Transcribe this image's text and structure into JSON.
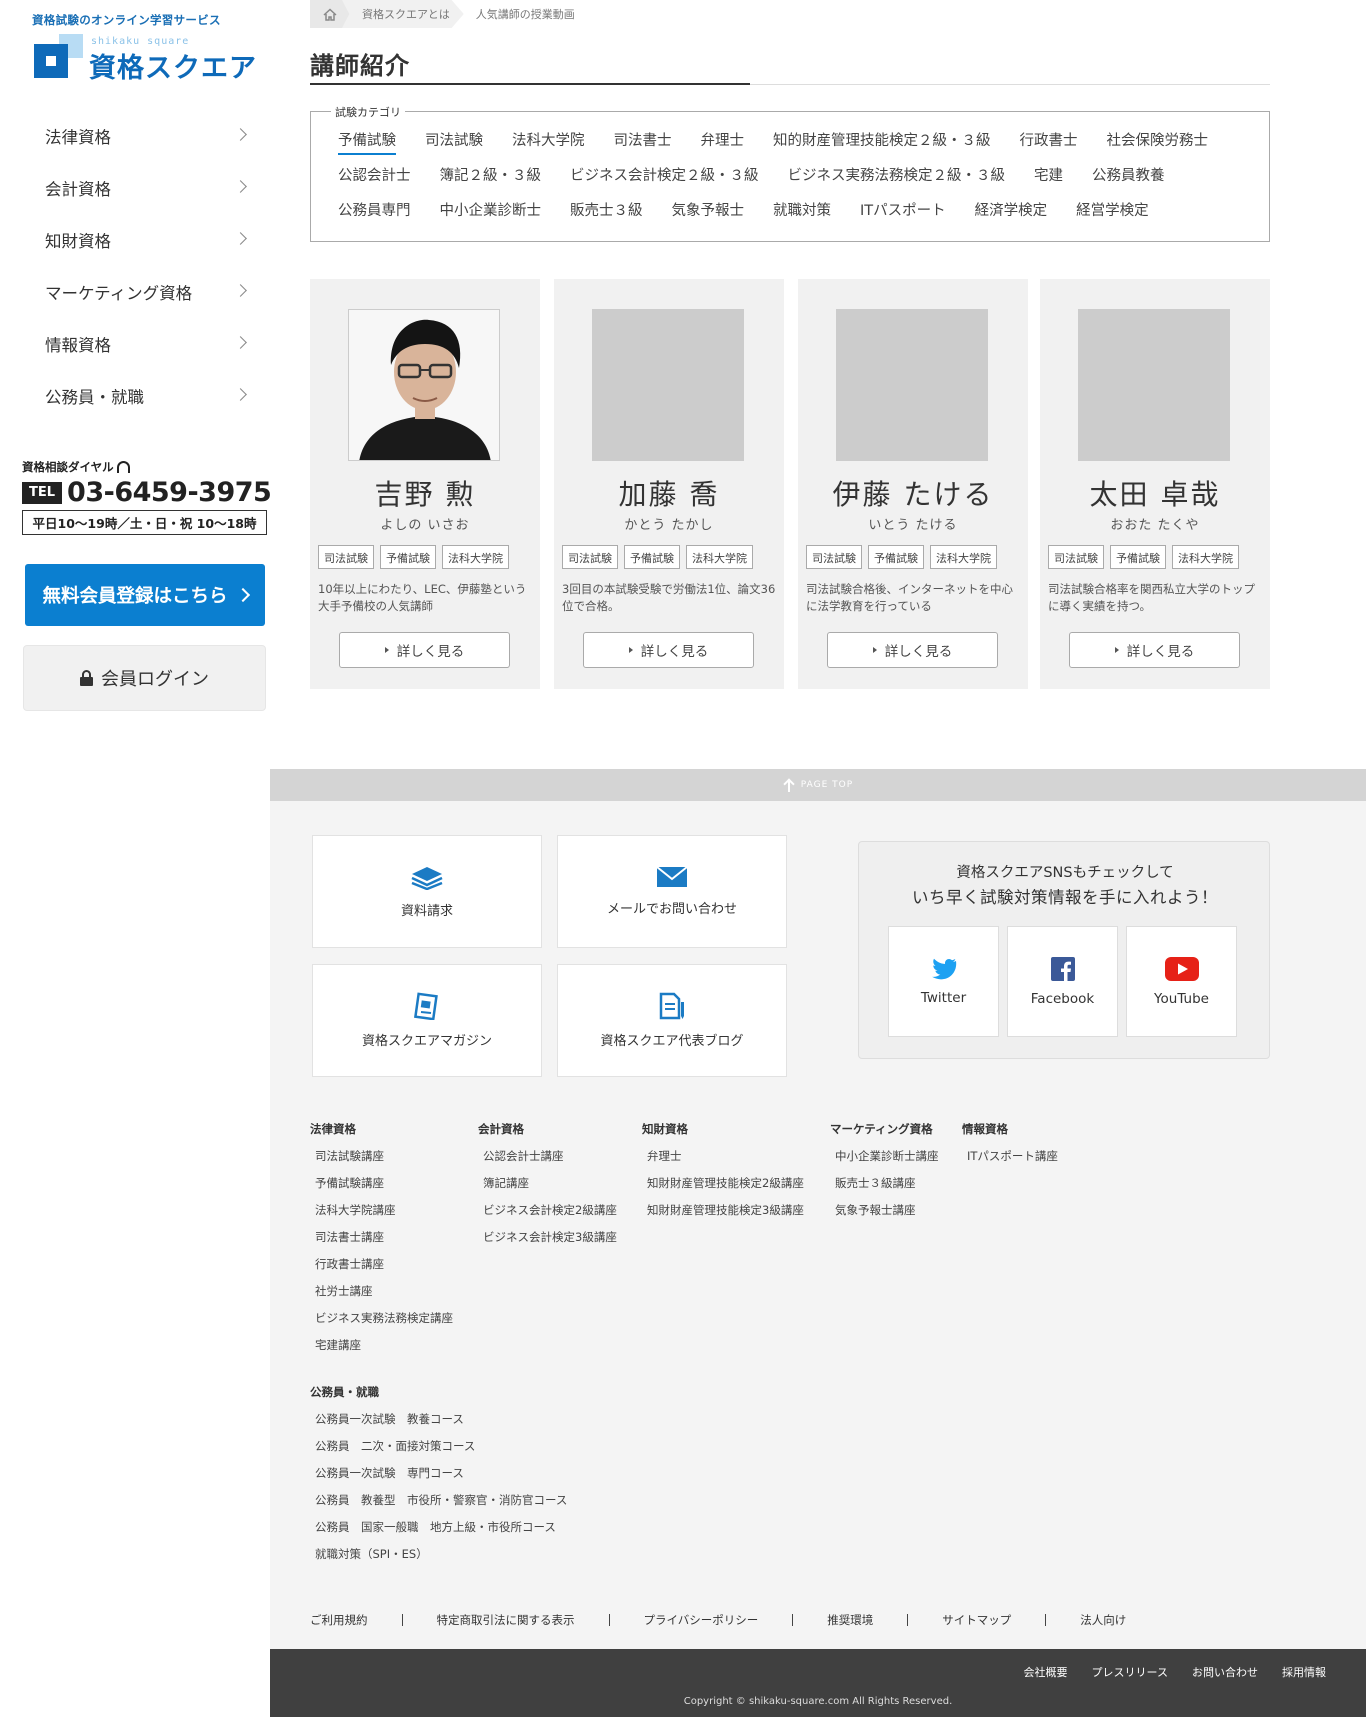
{
  "sidebar": {
    "tagline": "資格試験のオンライン学習サービス",
    "logo": {
      "romaji": "shikaku square",
      "name": "資格スクエア"
    },
    "nav": [
      {
        "label": "法律資格"
      },
      {
        "label": "会計資格"
      },
      {
        "label": "知財資格"
      },
      {
        "label": "マーケティング資格"
      },
      {
        "label": "情報資格"
      },
      {
        "label": "公務員・就職"
      }
    ],
    "dial": {
      "label": "資格相談ダイヤル",
      "tel_badge": "TEL",
      "number": "03-6459-3975",
      "hours": "平日10〜19時／土・日・祝 10〜18時"
    },
    "register_button": "無料会員登録はこちら",
    "login_button": "会員ログイン"
  },
  "breadcrumb": {
    "items": [
      "資格スクエアとは",
      "人気講師の授業動画"
    ]
  },
  "page_title": "講師紹介",
  "categories": {
    "legend": "試験カテゴリ",
    "rows": [
      [
        "予備試験",
        "司法試験",
        "法科大学院",
        "司法書士",
        "弁理士",
        "知的財産管理技能検定２級・３級",
        "行政書士",
        "社会保険労務士"
      ],
      [
        "公認会計士",
        "簿記２級・３級",
        "ビジネス会計検定２級・３級",
        "ビジネス実務法務検定２級・３級",
        "宅建",
        "公務員教養"
      ],
      [
        "公務員専門",
        "中小企業診断士",
        "販売士３級",
        "気象予報士",
        "就職対策",
        "ITパスポート",
        "経済学検定",
        "経営学検定"
      ]
    ],
    "active": "予備試験"
  },
  "lecturers": [
    {
      "name": "吉野 勲",
      "kana": "よしの いさお",
      "tags": [
        "司法試験",
        "予備試験",
        "法科大学院"
      ],
      "desc": "10年以上にわたり、LEC、伊藤塾という大手予備校の人気講師",
      "button": "詳しく見る"
    },
    {
      "name": "加藤 喬",
      "kana": "かとう たかし",
      "tags": [
        "司法試験",
        "予備試験",
        "法科大学院"
      ],
      "desc": "3回目の本試験受験で労働法1位、論文36位で合格。",
      "button": "詳しく見る"
    },
    {
      "name": "伊藤 たける",
      "kana": "いとう たける",
      "tags": [
        "司法試験",
        "予備試験",
        "法科大学院"
      ],
      "desc": "司法試験合格後、インターネットを中心に法学教育を行っている",
      "button": "詳しく見る"
    },
    {
      "name": "太田 卓哉",
      "kana": "おおた たくや",
      "tags": [
        "司法試験",
        "予備試験",
        "法科大学院"
      ],
      "desc": "司法試験合格率を関西私立大学のトップに導く実績を持つ。",
      "button": "詳しく見る"
    }
  ],
  "footer": {
    "pagetop": "PAGE TOP",
    "link_tiles": [
      {
        "label": "資料請求",
        "icon": "books-icon"
      },
      {
        "label": "メールでお問い合わせ",
        "icon": "mail-icon"
      },
      {
        "label": "資格スクエアマガジン",
        "icon": "magazine-icon"
      },
      {
        "label": "資格スクエア代表ブログ",
        "icon": "blog-icon"
      }
    ],
    "sns": {
      "line1": "資格スクエアSNSもチェックして",
      "line2": "いち早く試験対策情報を手に入れよう！",
      "items": [
        {
          "label": "Twitter",
          "color": "#1da1f2"
        },
        {
          "label": "Facebook",
          "color": "#3b5998"
        },
        {
          "label": "YouTube",
          "color": "#e62117"
        }
      ]
    },
    "sitemap": [
      {
        "heading": "法律資格",
        "links": [
          "司法試験講座",
          "予備試験講座",
          "法科大学院講座",
          "司法書士講座",
          "行政書士講座",
          "社労士講座",
          "ビジネス実務法務検定講座",
          "宅建講座"
        ]
      },
      {
        "heading": "会計資格",
        "links": [
          "公認会計士講座",
          "簿記講座",
          "ビジネス会計検定2級講座",
          "ビジネス会計検定3級講座"
        ]
      },
      {
        "heading": "知財資格",
        "links": [
          "弁理士",
          "知財財産管理技能検定2級講座",
          "知財財産管理技能検定3級講座"
        ]
      },
      {
        "heading": "マーケティング資格",
        "links": [
          "中小企業診断士講座",
          "販売士３級講座",
          "気象予報士講座"
        ]
      },
      {
        "heading": "情報資格",
        "links": [
          "ITパスポート講座"
        ]
      },
      {
        "heading": "公務員・就職",
        "links": [
          "公務員一次試験　教養コース",
          "公務員　二次・面接対策コース",
          "公務員一次試験　専門コース",
          "公務員　教養型　市役所・警察官・消防官コース",
          "公務員　国家一般職　地方上級・市役所コース",
          "就職対策（SPI・ES）"
        ]
      }
    ],
    "legal": [
      "ご利用規約",
      "特定商取引法に関する表示",
      "プライバシーポリシー",
      "推奨環境",
      "サイトマップ",
      "法人向け"
    ],
    "corporate": [
      "会社概要",
      "プレスリリース",
      "お問い合わせ",
      "採用情報"
    ],
    "copyright": "Copyright © shikaku-square.com All Rights Reserved."
  }
}
